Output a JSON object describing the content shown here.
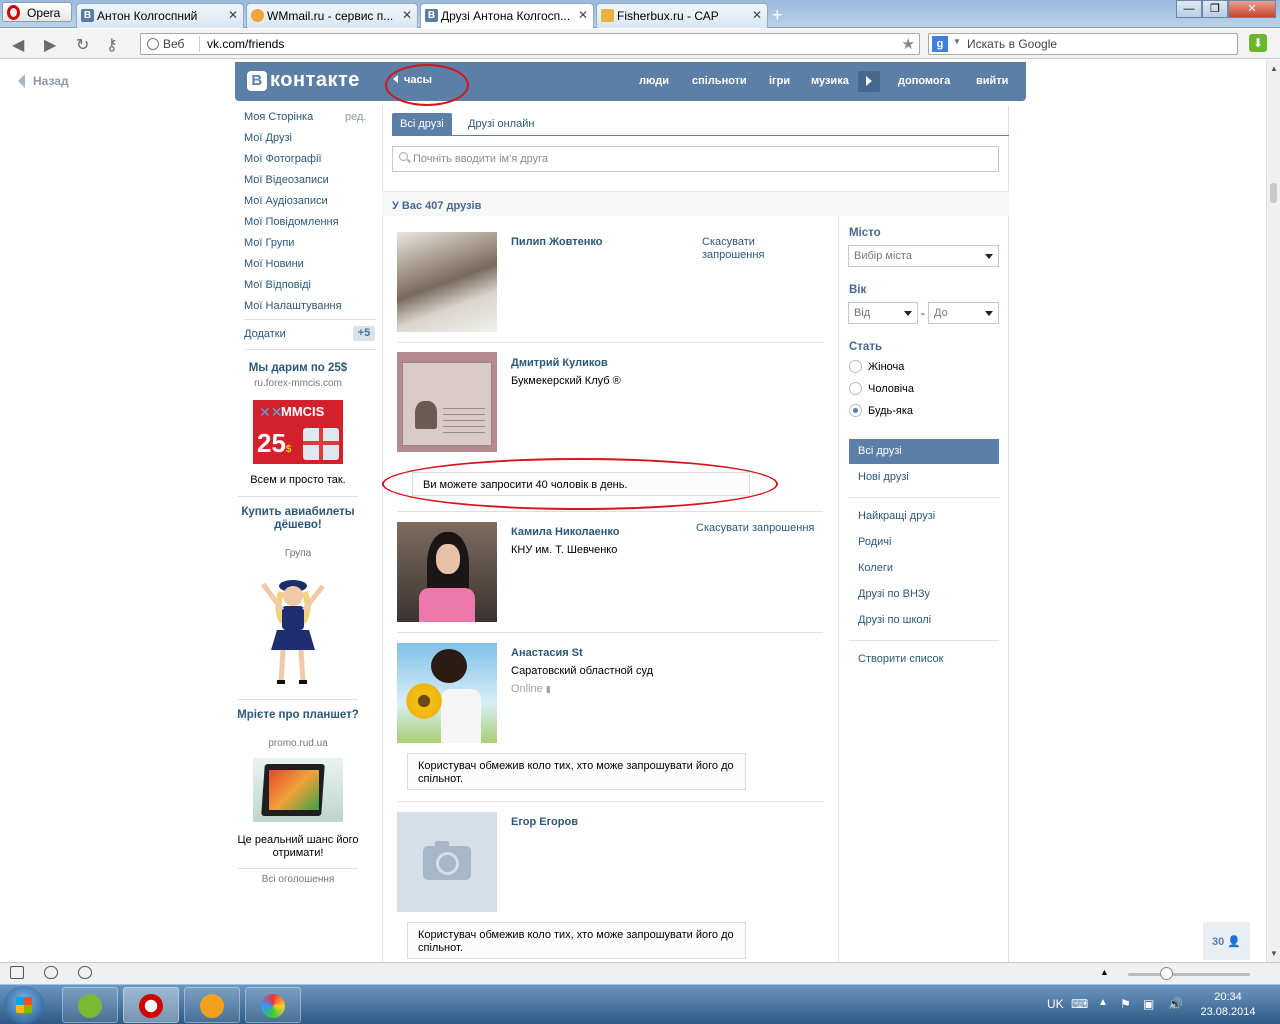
{
  "browser": {
    "menu_label": "Opera",
    "tabs": [
      {
        "title": "Антон Колгоспний"
      },
      {
        "title": "WMmail.ru - сервис п..."
      },
      {
        "title": "Друзі Антона Колгосп..."
      },
      {
        "title": "Fisherbux.ru - САР"
      }
    ],
    "web_label": "Веб",
    "url": "vk.com/friends",
    "search_placeholder": "Искать в Google"
  },
  "page": {
    "back_label": "Назад",
    "header": {
      "logo_b": "В",
      "logo_text": "контакте",
      "clock_label": "часы",
      "nav": [
        "люди",
        "спільноти",
        "ігри",
        "музика",
        "допомога",
        "вийти"
      ]
    },
    "left_menu": {
      "items": [
        "Моя Сторінка",
        "Мої Друзі",
        "Мої Фотографії",
        "Мої Відеозаписи",
        "Мої Аудіозаписи",
        "Мої Повідомлення",
        "Мої Групи",
        "Мої Новини",
        "Мої Відповіді",
        "Мої Налаштування"
      ],
      "edit_label": "ред.",
      "addons_label": "Додатки",
      "addons_badge": "+5"
    },
    "ads": [
      {
        "title": "Мы дарим по 25$",
        "domain": "ru.forex-mmcis.com",
        "banner_brand": "MMCIS",
        "banner_amount": "25",
        "banner_currency": "$",
        "text": "Всем и просто так."
      },
      {
        "title": "Купить авиабилеты дёшево!",
        "domain": "Група"
      },
      {
        "title": "Мрієте про планшет?",
        "domain": "promo.rud.ua",
        "text": "Це реальний шанс його отримати!"
      }
    ],
    "all_ads_label": "Всі оголошення",
    "tabs": {
      "all": "Всі друзі",
      "online": "Друзі онлайн"
    },
    "search_placeholder": "Почніть вводити ім'я друга",
    "friends_count_label": "У Вас 407 друзів",
    "friends": [
      {
        "name": "Пилип Жовтенко",
        "action": "Скасувати запрошення"
      },
      {
        "name": "Дмитрий Куликов",
        "sub": "Букмекерский Клуб ®"
      },
      {
        "name": "Камила Николаенко",
        "sub": "КНУ им. Т. Шевченко",
        "action": "Скасувати запрошення"
      },
      {
        "name": "Анастасия St",
        "sub": "Саратовский областной суд",
        "online": "Online"
      },
      {
        "name": "Егор Егоров"
      }
    ],
    "invite_limit_note": "Ви можете запросити 40 чоловік в день.",
    "restricted_note": "Користувач обмежив коло тих, хто може запрошувати його до спільнот.",
    "filters": {
      "city_label": "Місто",
      "city_select": "Вибір міста",
      "age_label": "Вік",
      "age_from": "Від",
      "age_dash": "-",
      "age_to": "До",
      "gender_label": "Стать",
      "gender_options": [
        "Жіноча",
        "Чоловіча",
        "Будь-яка"
      ],
      "gender_selected": "Будь-яка"
    },
    "sections": [
      "Всі друзі",
      "Нові друзі",
      "Найкращі друзі",
      "Родичі",
      "Колеги",
      "Друзі по ВНЗу",
      "Друзі по школі",
      "Створити список"
    ],
    "scroll_up_count": "30"
  },
  "taskbar": {
    "language": "UK",
    "time": "20:34",
    "date": "23.08.2014"
  }
}
